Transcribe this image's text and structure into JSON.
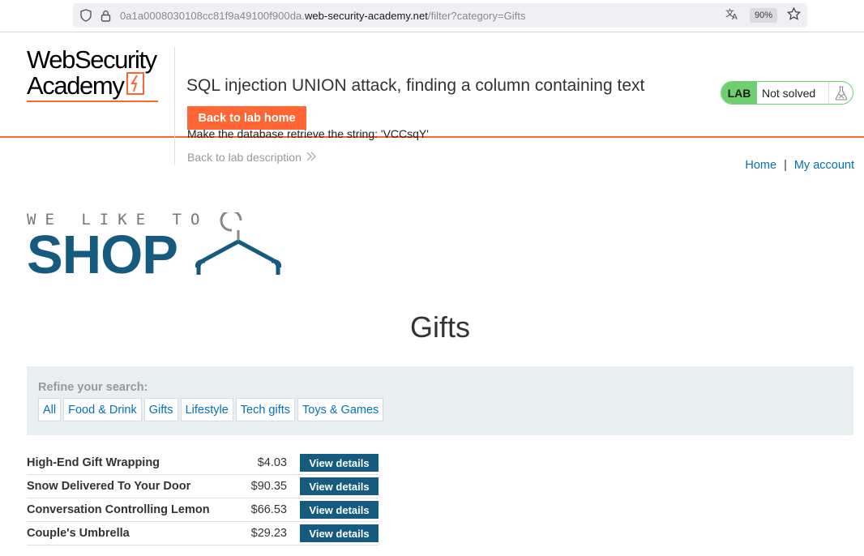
{
  "browser": {
    "url_prefix": "0a1a0008030108cc81f9a49100f900da.",
    "url_domain": "web-security-academy.net",
    "url_path": "/filter?category=Gifts",
    "zoom": "90%"
  },
  "lab": {
    "logo_line1": "WebSecurity",
    "logo_line2": "Academy",
    "title": "SQL injection UNION attack, finding a column containing text",
    "home_button": "Back to lab home",
    "description": "Make the database retrieve the string: 'VCCsqY'",
    "back_link": "Back to lab description",
    "badge": "LAB",
    "status": "Not solved"
  },
  "nav": {
    "home": "Home",
    "separator": "|",
    "account": "My account"
  },
  "shop": {
    "tagline": "WE LIKE TO",
    "word": "SHOP"
  },
  "page_heading": "Gifts",
  "refine": {
    "title": "Refine your search:",
    "filters": [
      "All",
      "Food & Drink",
      "Gifts",
      "Lifestyle",
      "Tech gifts",
      "Toys & Games"
    ]
  },
  "products": [
    {
      "name": "High-End Gift Wrapping",
      "price": "$4.03",
      "button": "View details"
    },
    {
      "name": "Snow Delivered To Your Door",
      "price": "$90.35",
      "button": "View details"
    },
    {
      "name": "Conversation Controlling Lemon",
      "price": "$66.53",
      "button": "View details"
    },
    {
      "name": "Couple's Umbrella",
      "price": "$29.23",
      "button": "View details"
    }
  ],
  "colors": {
    "accent": "#ff6633",
    "brand": "#155b7f",
    "link": "#0071bc",
    "lab_green": "#6fcf70"
  }
}
